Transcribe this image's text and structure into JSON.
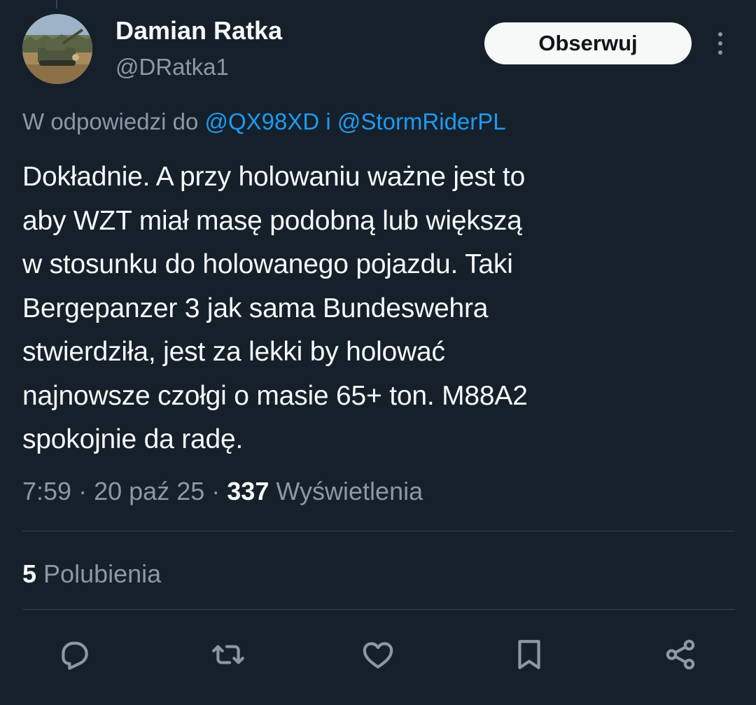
{
  "author": {
    "display_name": "Damian Ratka",
    "handle": "@DRatka1"
  },
  "follow_button": {
    "label": "Obserwuj"
  },
  "reply_context": {
    "prefix": "W odpowiedzi do",
    "mention1": "@QX98XD",
    "joiner": "i",
    "mention2": "@StormRiderPL"
  },
  "tweet": {
    "text": "Dokładnie. A przy holowaniu ważne jest to\naby WZT miał masę podobną lub większą\nw stosunku do holowanego pojazdu. Taki\nBergepanzer 3 jak sama Bundeswehra\nstwierdziła, jest za lekki by holować\nnajnowsze czołgi o masie 65+ ton. M88A2\nspokojnie da radę."
  },
  "meta": {
    "time": "7:59",
    "separator": "·",
    "date": "20 paź 25",
    "views_count": "337",
    "views_label": "Wyświetlenia"
  },
  "stats": {
    "likes_count": "5",
    "likes_label": "Polubienia"
  },
  "actions": [
    {
      "icon": "reply-icon"
    },
    {
      "icon": "retweet-icon"
    },
    {
      "icon": "like-icon"
    },
    {
      "icon": "bookmark-icon"
    },
    {
      "icon": "share-icon"
    }
  ],
  "colors": {
    "background": "#15202b",
    "text_primary": "#f7f9f9",
    "text_secondary": "#8b98a5",
    "link": "#1d9bf0",
    "divider": "#38444d",
    "button_bg": "#f7f9f9",
    "button_text": "#0f1419"
  }
}
